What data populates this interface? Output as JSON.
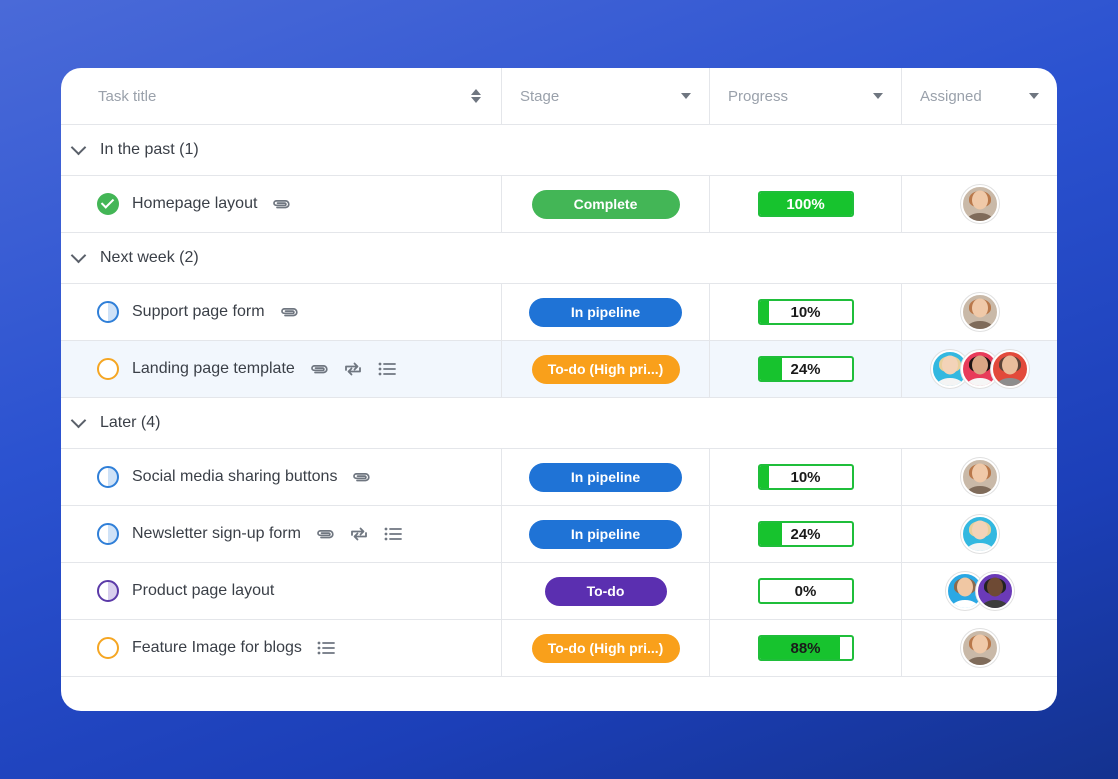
{
  "columns": {
    "task_title": "Task title",
    "stage": "Stage",
    "progress": "Progress",
    "assigned": "Assigned"
  },
  "groups": [
    {
      "label": "In the past (1)",
      "tasks": [
        {
          "title": "Homepage layout",
          "status": "complete",
          "icons": [
            "attachment"
          ],
          "stage": "Complete",
          "stage_style": "complete",
          "progress": 1.0,
          "progress_label": "100%",
          "assignees": [
            "woman-glasses"
          ]
        }
      ]
    },
    {
      "label": "Next week (2)",
      "tasks": [
        {
          "title": "Support page form",
          "status": "in-progress-blue",
          "icons": [
            "attachment"
          ],
          "stage": "In pipeline",
          "stage_style": "pipeline",
          "progress": 0.1,
          "progress_label": "10%",
          "assignees": [
            "woman-glasses"
          ]
        },
        {
          "title": "Landing page template",
          "status": "open-orange",
          "icons": [
            "attachment",
            "repeat",
            "checklist"
          ],
          "stage": "To-do (High pri...)",
          "stage_style": "high",
          "progress": 0.24,
          "progress_label": "24%",
          "assignees": [
            "woman-blonde",
            "woman-dark",
            "man-red"
          ]
        }
      ]
    },
    {
      "label": "Later (4)",
      "tasks": [
        {
          "title": "Social media sharing buttons",
          "status": "in-progress-blue",
          "icons": [
            "attachment"
          ],
          "stage": "In pipeline",
          "stage_style": "pipeline",
          "progress": 0.1,
          "progress_label": "10%",
          "assignees": [
            "woman-glasses"
          ]
        },
        {
          "title": "Newsletter sign-up form",
          "status": "in-progress-blue",
          "icons": [
            "attachment",
            "repeat",
            "checklist"
          ],
          "stage": "In pipeline",
          "stage_style": "pipeline",
          "progress": 0.24,
          "progress_label": "24%",
          "assignees": [
            "woman-blonde"
          ]
        },
        {
          "title": "Product page layout",
          "status": "in-progress-purple",
          "icons": [],
          "stage": "To-do",
          "stage_style": "todo",
          "progress": 0.0,
          "progress_label": "0%",
          "assignees": [
            "man-light",
            "man-dark"
          ]
        },
        {
          "title": "Feature Image for blogs",
          "status": "open-orange",
          "icons": [
            "checklist"
          ],
          "stage": "To-do (High pri...)",
          "stage_style": "high",
          "progress": 0.88,
          "progress_label": "88%",
          "assignees": [
            "woman-glasses"
          ]
        }
      ]
    }
  ],
  "colors": {
    "complete": "#43b656",
    "pipeline": "#1f73d6",
    "high": "#f9a01b",
    "todo": "#5b2fb0",
    "progress_fill": "#17c32e"
  }
}
